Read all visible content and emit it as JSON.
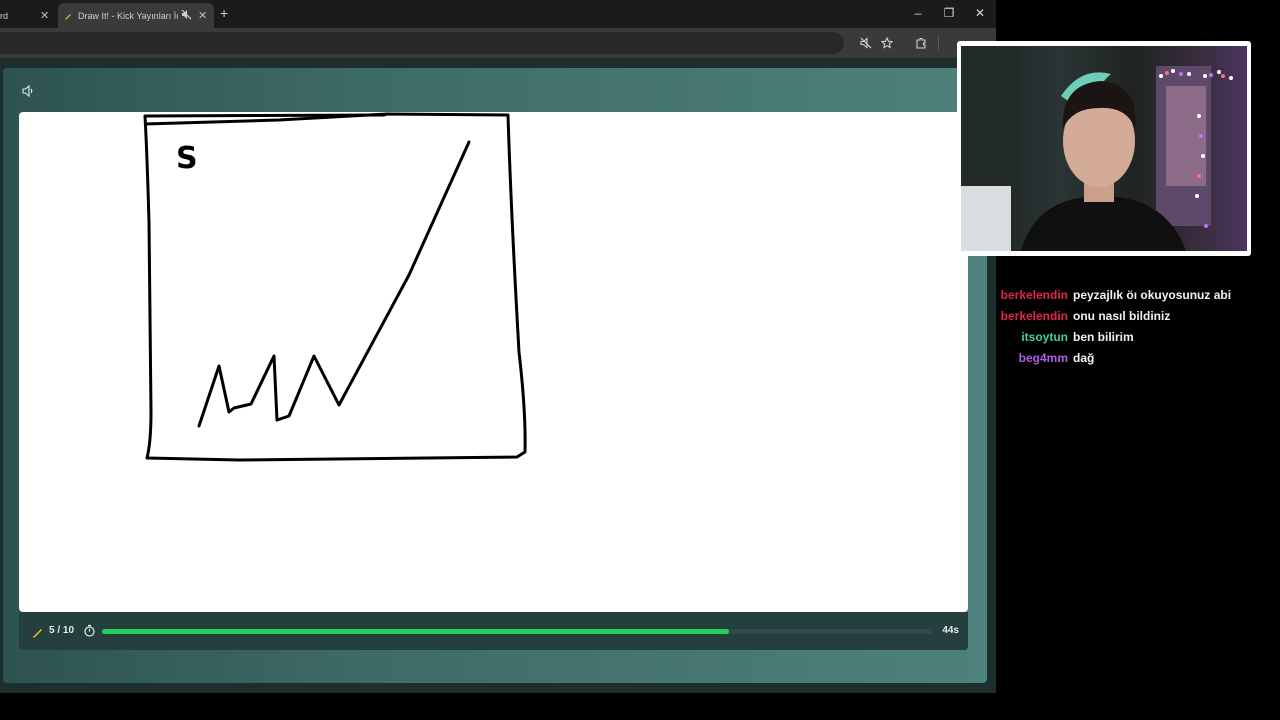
{
  "browser": {
    "prev_tab_fragment": "rd",
    "active_tab_title": "Draw It! - Kick Yayınları İçin",
    "new_tab_label": "+",
    "window_controls": {
      "minimize": "–",
      "restore": "❐",
      "close": "✕"
    },
    "tab_close": "✕",
    "toolbar_icons": [
      "mute-site-icon",
      "bookmark-star-icon",
      "extensions-icon"
    ]
  },
  "game": {
    "round_label": "5 / 10",
    "time_left": "44s",
    "progress": 0.755,
    "progress_color": "#22d15c",
    "drawing_text": "S"
  },
  "chat": {
    "messages": [
      {
        "user": "berkelendin",
        "color": "#e0264a",
        "text": "peyzajlık öı okuyosunuz abi"
      },
      {
        "user": "berkelendin",
        "color": "#e0264a",
        "text": "onu nasıl bildiniz"
      },
      {
        "user": "itsoytun",
        "color": "#3ecf9e",
        "text": "ben bilirim"
      },
      {
        "user": "beg4mm",
        "color": "#b05ee8",
        "text": "dağ"
      }
    ]
  }
}
